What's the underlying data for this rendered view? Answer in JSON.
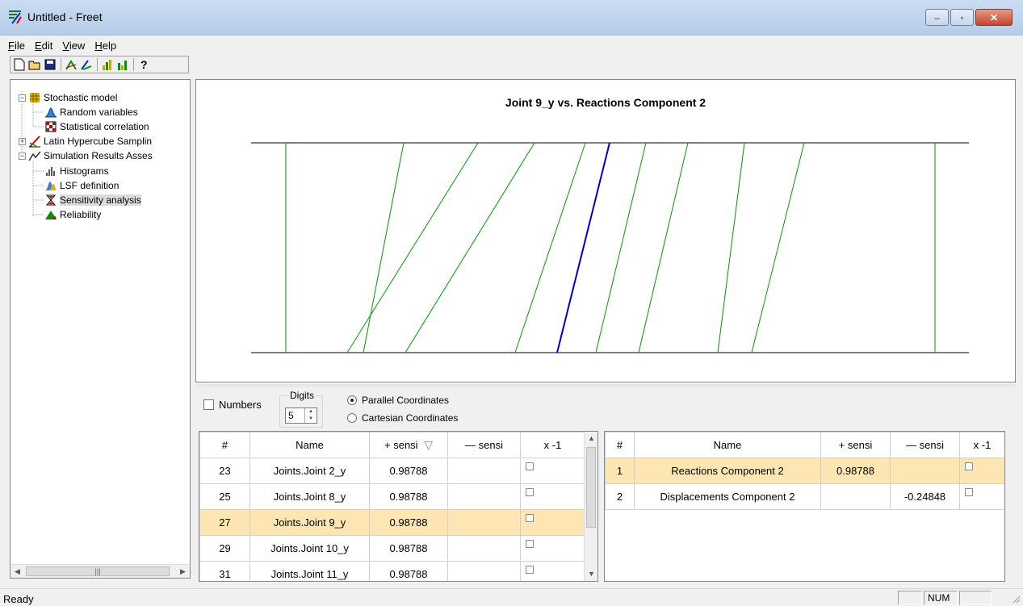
{
  "window": {
    "title": "Untitled - Freet",
    "minimize": "–",
    "maximize": "▫",
    "close": "✕"
  },
  "menu": {
    "file": "File",
    "edit": "Edit",
    "view": "View",
    "help": "Help"
  },
  "tree": {
    "stochastic_model": "Stochastic model",
    "random_variables": "Random variables",
    "statistical_correlation": "Statistical correlation",
    "latin_hypercube": "Latin Hypercube Samplin",
    "simulation_results": "Simulation Results Asses",
    "histograms": "Histograms",
    "lsf_definition": "LSF definition",
    "sensitivity_analysis": "Sensitivity analysis",
    "reliability": "Reliability"
  },
  "plot": {
    "title": "Joint 9_y vs. Reactions Component 2",
    "type": "parallel-coordinates",
    "line_color": "#009900",
    "highlight_color": "#0000cc"
  },
  "controls": {
    "numbers_label": "Numbers",
    "digits_label": "Digits",
    "digits_value": "5",
    "parallel_label": "Parallel Coordinates",
    "cartesian_label": "Cartesian Coordinates",
    "mode": "parallel"
  },
  "left_table": {
    "headers": [
      "#",
      "Name",
      "+ sensi",
      "— sensi",
      "x -1"
    ],
    "sort_icon": "▽",
    "rows": [
      {
        "num": "23",
        "name": "Joints.Joint 2_y",
        "plus": "0.98788",
        "minus": ""
      },
      {
        "num": "25",
        "name": "Joints.Joint 8_y",
        "plus": "0.98788",
        "minus": ""
      },
      {
        "num": "27",
        "name": "Joints.Joint 9_y",
        "plus": "0.98788",
        "minus": ""
      },
      {
        "num": "29",
        "name": "Joints.Joint 10_y",
        "plus": "0.98788",
        "minus": ""
      },
      {
        "num": "31",
        "name": "Joints.Joint 11_y",
        "plus": "0.98788",
        "minus": ""
      }
    ]
  },
  "right_table": {
    "headers": [
      "#",
      "Name",
      "+ sensi",
      "— sensi",
      "x -1"
    ],
    "rows": [
      {
        "num": "1",
        "name": "Reactions Component 2",
        "plus": "0.98788",
        "minus": ""
      },
      {
        "num": "2",
        "name": "Displacements Component 2",
        "plus": "",
        "minus": "-0.24848"
      }
    ]
  },
  "status": {
    "text": "Ready",
    "num": "NUM"
  }
}
